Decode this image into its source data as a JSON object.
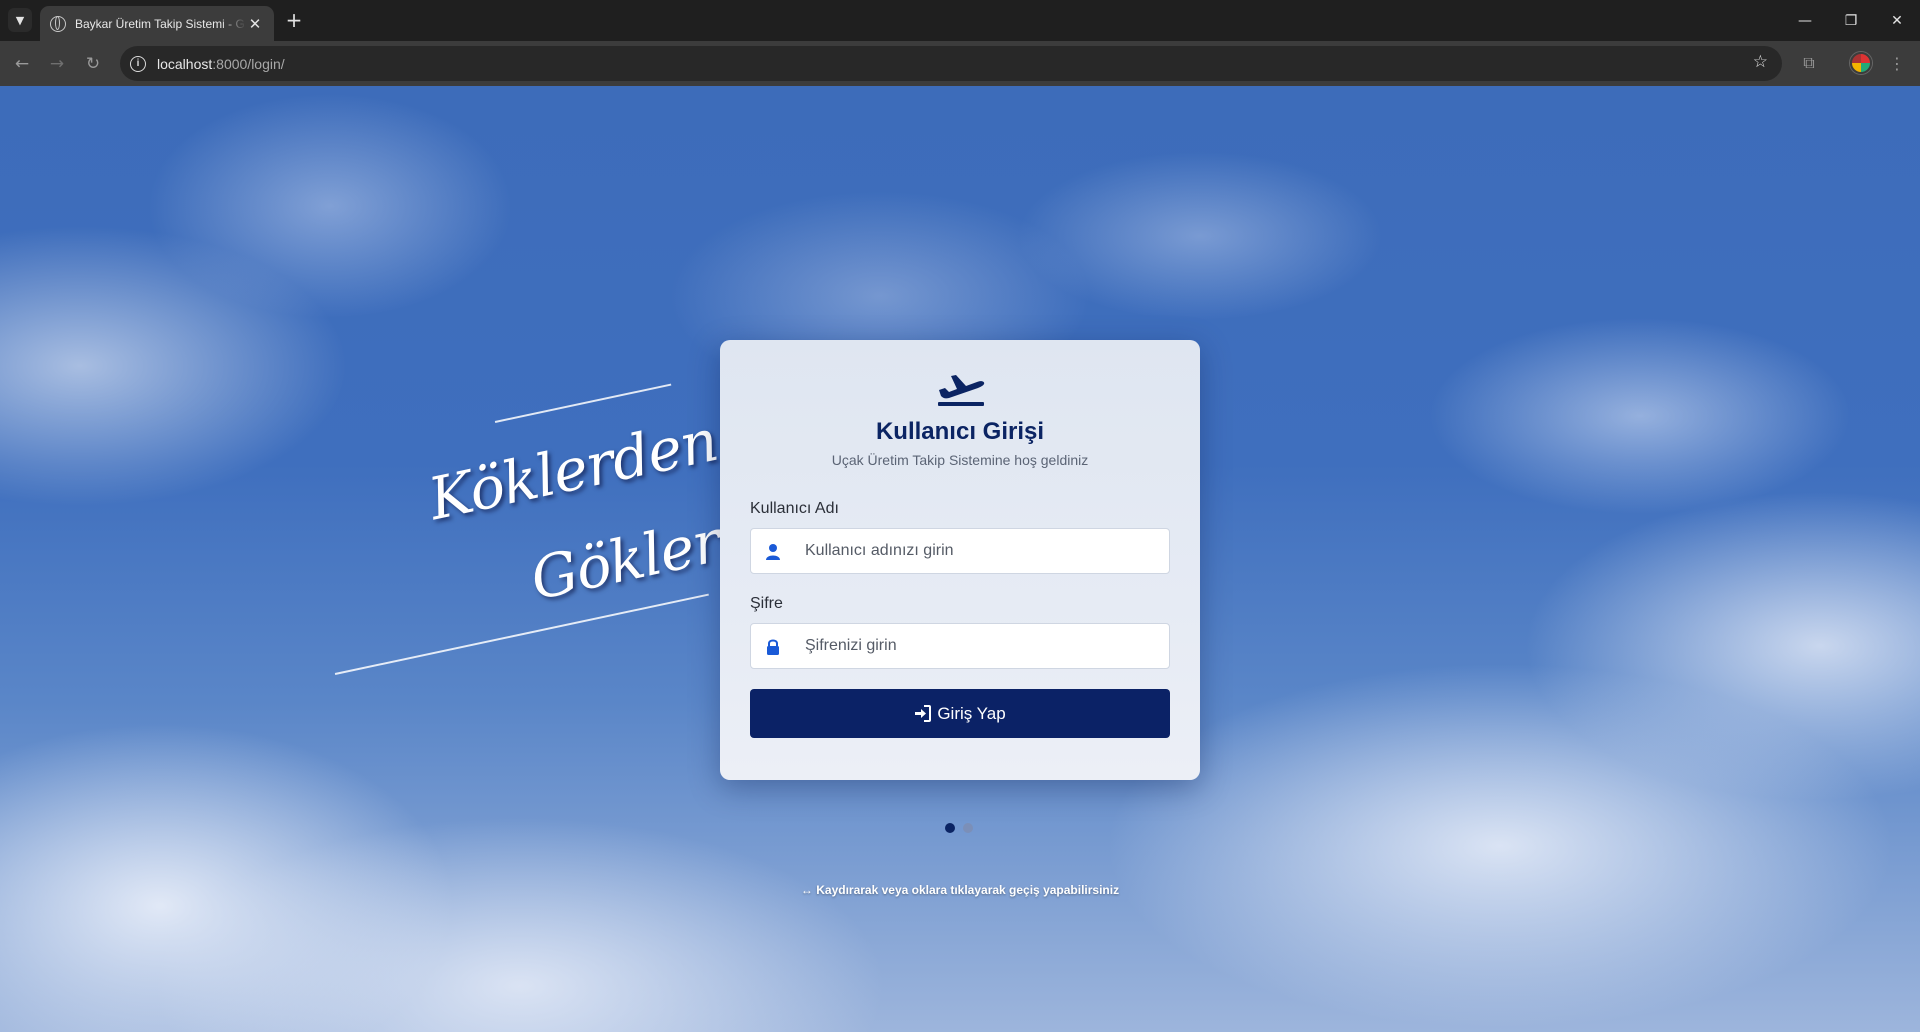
{
  "browser": {
    "tab_title": "Baykar Üretim Takip Sistemi - G",
    "tab_close": "✕",
    "new_tab": "+",
    "url_host": "localhost",
    "url_rest": ":8000/login/",
    "window_controls": {
      "minimize": "—",
      "maximize": "❐",
      "close": "✕"
    },
    "icons": [
      "tab-search-icon",
      "globe-icon",
      "back-icon",
      "forward-icon",
      "reload-icon",
      "site-info-icon",
      "bookmark-star-icon",
      "extensions-icon",
      "profile-avatar",
      "more-menu-icon"
    ]
  },
  "hero": {
    "line1": "Köklerden",
    "line2": "Göklere"
  },
  "login": {
    "title": "Kullanıcı Girişi",
    "subtitle": "Uçak Üretim Takip Sistemine hoş geldiniz",
    "username_label": "Kullanıcı Adı",
    "username_placeholder": "Kullanıcı adınızı girin",
    "username_value": "",
    "password_label": "Şifre",
    "password_placeholder": "Şifrenizi girin",
    "password_value": "",
    "submit_label": "Giriş Yap"
  },
  "carousel": {
    "prev": "‹",
    "next": "›",
    "slide_count": 2,
    "active_index": 0,
    "hint": "↔ Kaydırarak veya oklara tıklayarak geçiş yapabilirsiniz"
  },
  "colors": {
    "brand_navy": "#0b2266",
    "title_navy": "#0b2463",
    "icon_blue": "#1a5ad7"
  }
}
